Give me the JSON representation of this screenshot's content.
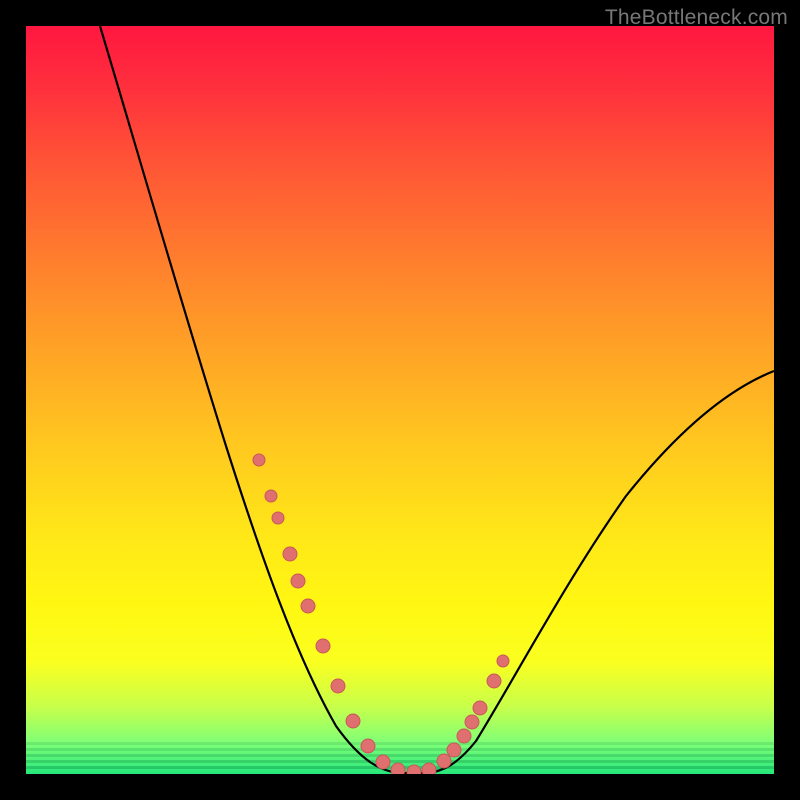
{
  "watermark": "TheBottleneck.com",
  "colors": {
    "frame": "#000000",
    "curve": "#000000",
    "marker_fill": "#e07070",
    "marker_stroke": "#c85858"
  },
  "chart_data": {
    "type": "line",
    "title": "",
    "xlabel": "",
    "ylabel": "",
    "xlim": [
      0,
      100
    ],
    "ylim": [
      0,
      100
    ],
    "grid": false,
    "legend": false,
    "notes": "V-shaped bottleneck curve over a vertical red→green gradient. Y-axis is inverted visually (higher on image = higher bottleneck). No tick labels shown.",
    "series": [
      {
        "name": "bottleneck-curve",
        "x": [
          10,
          14,
          18,
          22,
          26,
          30,
          33,
          36,
          38,
          40,
          42,
          44,
          46,
          48,
          50,
          52,
          55,
          58,
          62,
          66,
          70,
          75,
          80,
          85,
          90,
          95,
          100
        ],
        "y": [
          100,
          89,
          78,
          67,
          56,
          46,
          38,
          30,
          24,
          18,
          12,
          7,
          3,
          1,
          0,
          0,
          1,
          3,
          7,
          12,
          18,
          25,
          32,
          39,
          45,
          50,
          54
        ]
      }
    ],
    "markers": {
      "name": "highlighted-points",
      "x": [
        31,
        33,
        34,
        36,
        37,
        38,
        40,
        42,
        44,
        46,
        48,
        50,
        52,
        54,
        56,
        57,
        58,
        59,
        60,
        62,
        63
      ],
      "y": [
        42,
        37,
        34,
        29,
        26,
        23,
        17,
        11,
        6,
        3,
        1,
        0,
        0,
        1,
        3,
        4,
        6,
        8,
        10,
        14,
        17
      ]
    }
  }
}
